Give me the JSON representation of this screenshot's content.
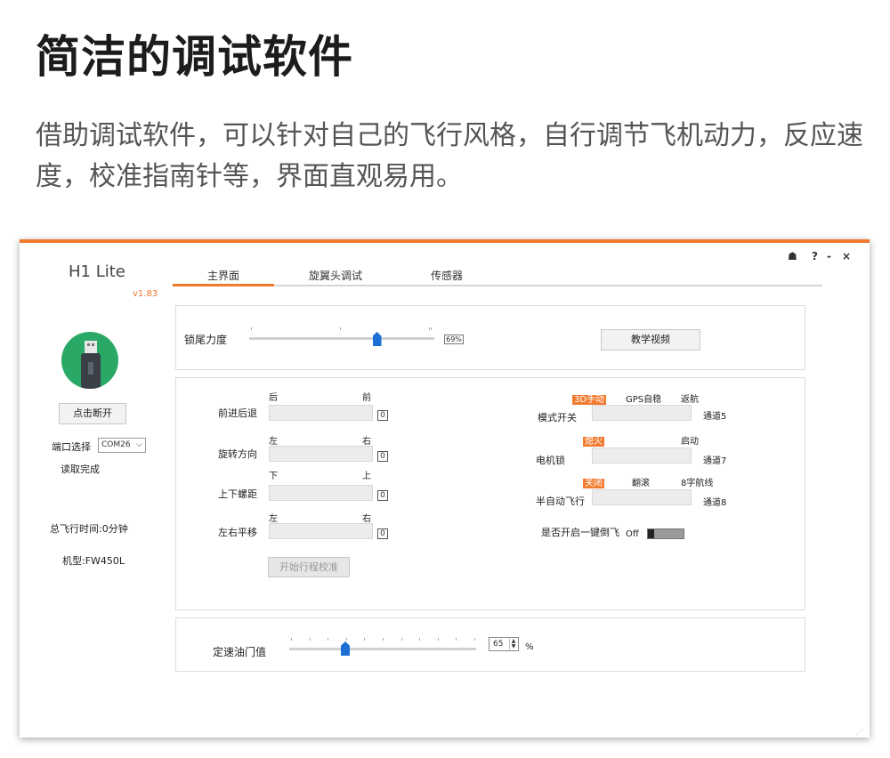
{
  "hero": {
    "title": "简洁的调试软件",
    "description": "借助调试软件，可以针对自己的飞行风格，自行调节飞机动力，反应速度，校准指南针等，界面直观易用。"
  },
  "app": {
    "title": "H1 Lite",
    "version": "v1.83",
    "window_controls": {
      "skin": "☗",
      "help": "?",
      "minimize": "-",
      "close": "×"
    },
    "tabs": [
      "主界面",
      "旋翼头调试",
      "传感器"
    ],
    "sidebar": {
      "disconnect_label": "点击断开",
      "port_label": "端口选择",
      "port_value": "COM26",
      "read_status": "读取完成",
      "flight_time": "总飞行时间:0分钟",
      "model": "机型:FW450L"
    },
    "tail_panel": {
      "label": "锁尾力度",
      "value": "69%",
      "value_fraction": 0.69,
      "tutorial_button": "教学视频"
    },
    "sticks": [
      {
        "label": "前进后退",
        "left": "后",
        "right": "前",
        "value": "0"
      },
      {
        "label": "旋转方向",
        "left": "左",
        "right": "右",
        "value": "0"
      },
      {
        "label": "上下螺距",
        "left": "下",
        "right": "上",
        "value": "0"
      },
      {
        "label": "左右平移",
        "left": "左",
        "right": "右",
        "value": "0"
      }
    ],
    "start_calibration_button": "开始行程校准",
    "channels": [
      {
        "label": "模式开关",
        "options": [
          "3D手动",
          "GPS自稳",
          "返航"
        ],
        "active": "3D手动",
        "channel": "通道5"
      },
      {
        "label": "电机锁",
        "options": [
          "熄火",
          "启动"
        ],
        "active": "熄火",
        "channel": "通道7"
      },
      {
        "label": "半自动飞行",
        "options": [
          "关闭",
          "翻滚",
          "8字航线"
        ],
        "active": "关闭",
        "channel": "通道8"
      }
    ],
    "inverted_flight": {
      "label": "是否开启一键倒飞",
      "state": "Off"
    },
    "throttle": {
      "label": "定速油门值",
      "value": "65",
      "unit": "%",
      "value_fraction": 0.65
    }
  }
}
